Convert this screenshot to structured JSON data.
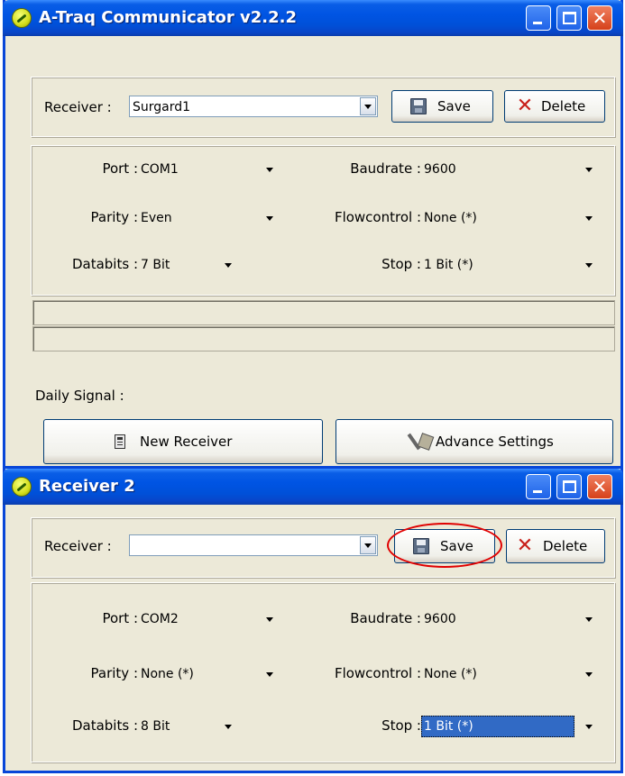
{
  "main_window": {
    "title": "A-Traq Communicator v2.2.2",
    "receiver_label": "Receiver :",
    "receiver_value": "Surgard1",
    "save_label": "Save",
    "delete_label": "Delete",
    "port_label": "Port :",
    "port_value": "COM1",
    "baudrate_label": "Baudrate :",
    "baudrate_value": "9600",
    "parity_label": "Parity :",
    "parity_value": "Even",
    "flowcontrol_label": "Flowcontrol :",
    "flowcontrol_value": "None (*)",
    "databits_label": "Databits :",
    "databits_value": "7 Bit",
    "stop_label": "Stop :",
    "stop_value": "1 Bit (*)",
    "daily_signal_label": "Daily Signal :",
    "new_receiver_label": "New Receiver",
    "advance_settings_label": "Advance Settings"
  },
  "receiver2_window": {
    "title": "Receiver 2",
    "receiver_label": "Receiver :",
    "receiver_value": "",
    "save_label": "Save",
    "delete_label": "Delete",
    "port_label": "Port :",
    "port_value": "COM2",
    "baudrate_label": "Baudrate :",
    "baudrate_value": "9600",
    "parity_label": "Parity :",
    "parity_value": "None (*)",
    "flowcontrol_label": "Flowcontrol :",
    "flowcontrol_value": "None (*)",
    "databits_label": "Databits :",
    "databits_value": "8 Bit",
    "stop_label": "Stop :",
    "stop_value": "1 Bit (*)"
  },
  "titlebar_buttons": {
    "close_glyph": "✕"
  },
  "icons": {
    "app": "atraq-logo-icon",
    "save": "floppy-disk-icon",
    "delete": "red-x-icon",
    "new_receiver": "device-icon",
    "advance_settings": "tools-icon"
  },
  "colors": {
    "titlebar": "#0054e3",
    "window_face": "#ece9d8",
    "selection": "#316ac5",
    "annotation": "#e00000"
  }
}
